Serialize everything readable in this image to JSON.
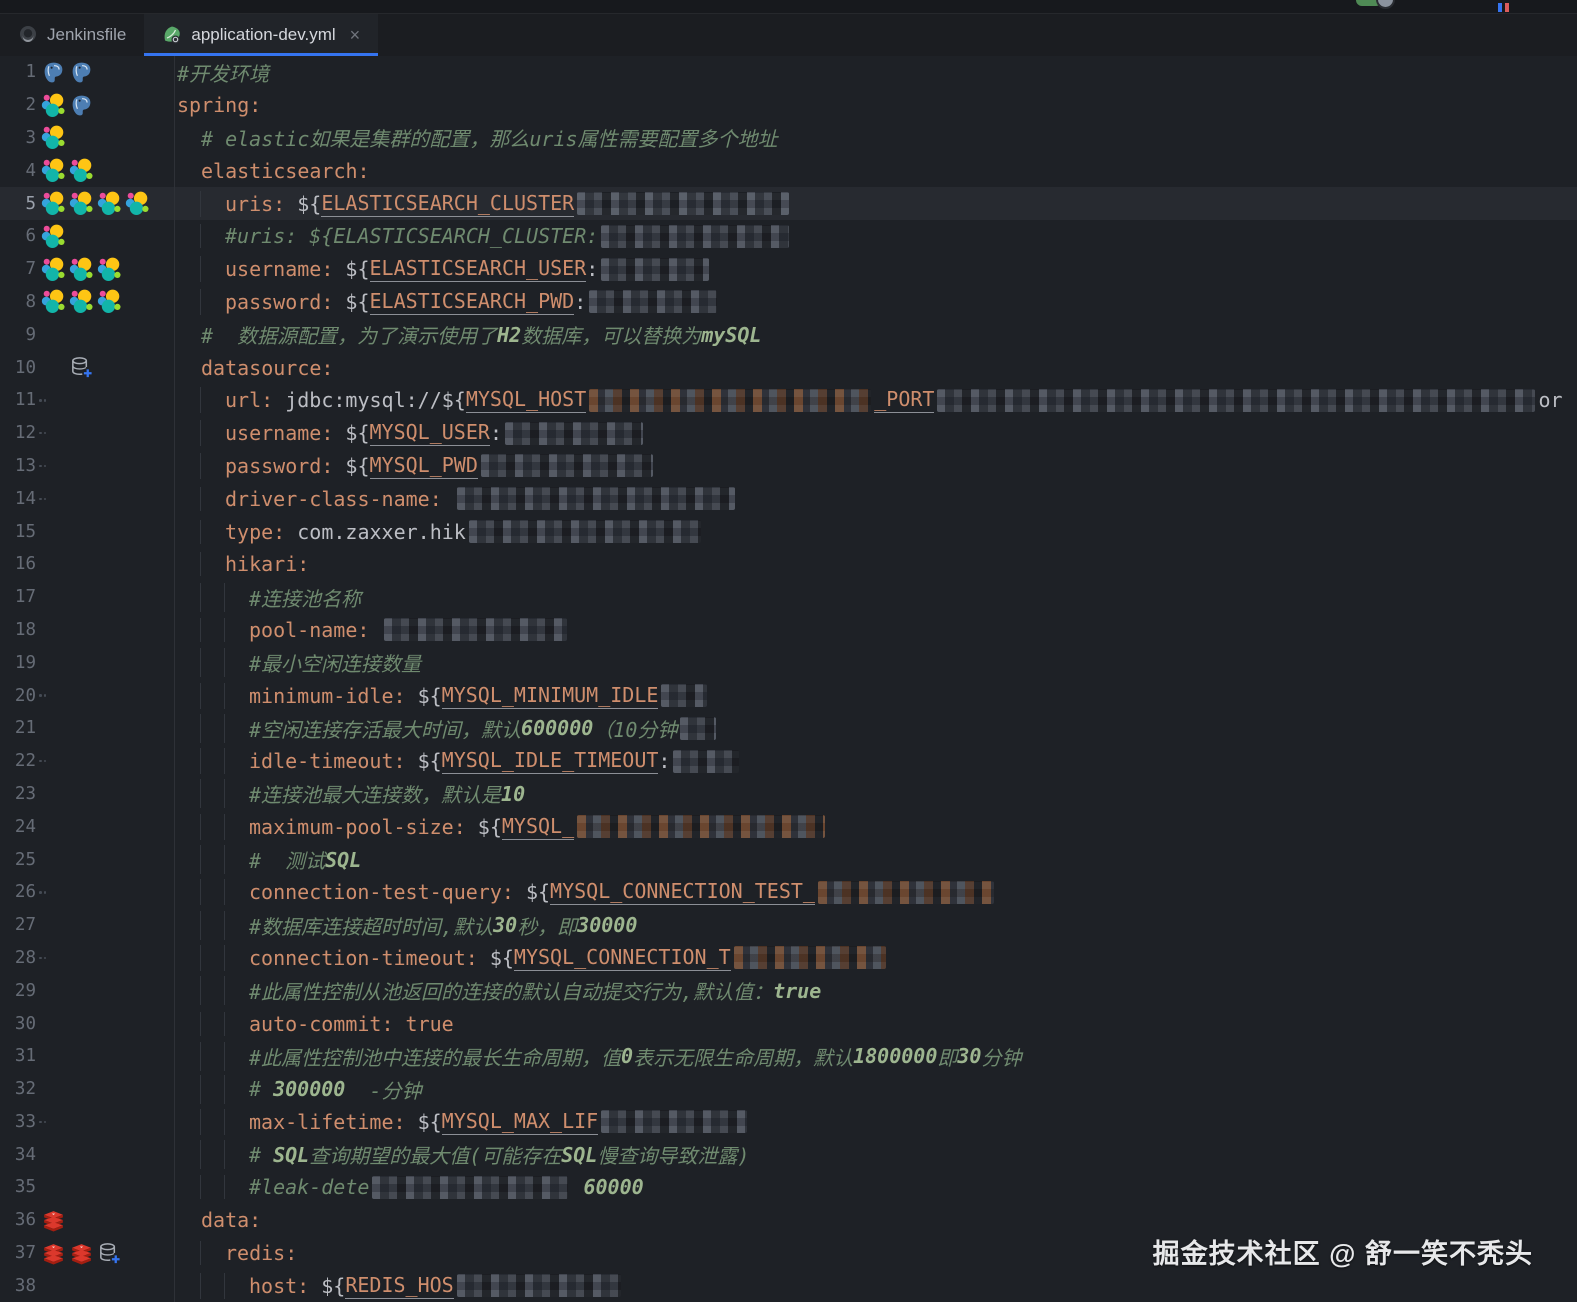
{
  "tabs": [
    {
      "label": "Jenkinsfile",
      "icon": "jenkins-icon",
      "active": false
    },
    {
      "label": "application-dev.yml",
      "icon": "spring-boot-icon",
      "active": true,
      "close": "×"
    }
  ],
  "watermark": "掘金技术社区 @ 舒一笑不秃头",
  "colors": {
    "editor_bg": "#1e2126",
    "current_line": "#272a30",
    "key": "#cf8e6d",
    "text": "#bcbec4",
    "comment": "#6f8a6f",
    "accent": "#3574f0"
  },
  "editor": {
    "file": "application-dev.yml",
    "lines": [
      {
        "n": 1,
        "icons": [
          "pg",
          "pg"
        ],
        "indent": 0,
        "seg": [
          [
            "c",
            "#开发环境"
          ]
        ]
      },
      {
        "n": 2,
        "icons": [
          "es",
          "pg"
        ],
        "indent": 0,
        "seg": [
          [
            "k",
            "spring:"
          ]
        ]
      },
      {
        "n": 3,
        "icons": [
          "es"
        ],
        "indent": 1,
        "seg": [
          [
            "c",
            "# elastic如果是集群的配置，那么uris属性需要配置多个地址"
          ]
        ]
      },
      {
        "n": 4,
        "icons": [
          "es",
          "es"
        ],
        "indent": 1,
        "seg": [
          [
            "k",
            "elasticsearch:"
          ]
        ]
      },
      {
        "n": 5,
        "icons": [
          "es",
          "es",
          "es",
          "es"
        ],
        "indent": 2,
        "current": true,
        "seg": [
          [
            "k",
            "uris: "
          ],
          [
            "p",
            "${"
          ],
          [
            "v",
            "ELASTICSEARCH_CLUSTER"
          ],
          [
            "m",
            212
          ]
        ]
      },
      {
        "n": 6,
        "icons": [
          "es"
        ],
        "indent": 2,
        "seg": [
          [
            "c",
            "#uris: ${ELASTICSEARCH_CLUSTER:"
          ],
          [
            "m",
            188
          ]
        ]
      },
      {
        "n": 7,
        "icons": [
          "es",
          "es",
          "es"
        ],
        "indent": 2,
        "seg": [
          [
            "k",
            "username: "
          ],
          [
            "p",
            "${"
          ],
          [
            "v",
            "ELASTICSEARCH_USER"
          ],
          [
            "p",
            ":"
          ],
          [
            "m",
            108
          ]
        ]
      },
      {
        "n": 8,
        "icons": [
          "es",
          "es",
          "es"
        ],
        "indent": 2,
        "seg": [
          [
            "k",
            "password: "
          ],
          [
            "p",
            "${"
          ],
          [
            "v",
            "ELASTICSEARCH_PWD"
          ],
          [
            "p",
            ":"
          ],
          [
            "m",
            128
          ]
        ]
      },
      {
        "n": 9,
        "indent": 1,
        "seg": [
          [
            "c",
            "#  数据源配置，为了演示使用了"
          ],
          [
            "cb",
            "H2"
          ],
          [
            "c",
            "数据库，可以替换为"
          ],
          [
            "cb",
            "mySQL"
          ]
        ]
      },
      {
        "n": 10,
        "icons": [
          "sp",
          "db"
        ],
        "indent": 1,
        "seg": [
          [
            "k",
            "datasource:"
          ]
        ]
      },
      {
        "n": 11,
        "dots": true,
        "indent": 2,
        "seg": [
          [
            "k",
            "url: "
          ],
          [
            "p",
            "jdbc:mysql://${"
          ],
          [
            "v",
            "MYSQL_HOST"
          ],
          [
            "mw",
            282
          ],
          [
            "v",
            "_PORT"
          ],
          [
            "m",
            598
          ],
          [
            "p",
            "or"
          ]
        ]
      },
      {
        "n": 12,
        "dots": true,
        "indent": 2,
        "seg": [
          [
            "k",
            "username: "
          ],
          [
            "p",
            "${"
          ],
          [
            "v",
            "MYSQL_USER"
          ],
          [
            "p",
            ":"
          ],
          [
            "m",
            138
          ]
        ]
      },
      {
        "n": 13,
        "dots": true,
        "indent": 2,
        "seg": [
          [
            "k",
            "password: "
          ],
          [
            "p",
            "${"
          ],
          [
            "v",
            "MYSQL_PWD"
          ],
          [
            "m",
            172
          ]
        ]
      },
      {
        "n": 14,
        "dots": true,
        "indent": 2,
        "seg": [
          [
            "k",
            "driver-class-name: "
          ],
          [
            "m",
            278
          ]
        ]
      },
      {
        "n": 15,
        "indent": 2,
        "seg": [
          [
            "k",
            "type: "
          ],
          [
            "p",
            "com.zaxxer.hik"
          ],
          [
            "m",
            232
          ]
        ]
      },
      {
        "n": 16,
        "indent": 2,
        "seg": [
          [
            "k",
            "hikari:"
          ]
        ]
      },
      {
        "n": 17,
        "indent": 3,
        "seg": [
          [
            "c",
            "#连接池名称"
          ]
        ]
      },
      {
        "n": 18,
        "indent": 3,
        "seg": [
          [
            "k",
            "pool-name: "
          ],
          [
            "m",
            183
          ]
        ]
      },
      {
        "n": 19,
        "indent": 3,
        "seg": [
          [
            "c",
            "#最小空闲连接数量"
          ]
        ]
      },
      {
        "n": 20,
        "dots": true,
        "indent": 3,
        "seg": [
          [
            "k",
            "minimum-idle: "
          ],
          [
            "p",
            "${"
          ],
          [
            "v",
            "MYSQL_MINIMUM_IDLE"
          ],
          [
            "m",
            46
          ]
        ]
      },
      {
        "n": 21,
        "indent": 3,
        "seg": [
          [
            "c",
            "#空闲连接存活最大时间，默认"
          ],
          [
            "cb",
            "600000"
          ],
          [
            "c",
            "（10分钟"
          ],
          [
            "m",
            36
          ]
        ]
      },
      {
        "n": 22,
        "dots": true,
        "indent": 3,
        "seg": [
          [
            "k",
            "idle-timeout: "
          ],
          [
            "p",
            "${"
          ],
          [
            "v",
            "MYSQL_IDLE_TIMEOUT"
          ],
          [
            "p",
            ":"
          ],
          [
            "m",
            66
          ]
        ]
      },
      {
        "n": 23,
        "indent": 3,
        "seg": [
          [
            "c",
            "#连接池最大连接数，默认是"
          ],
          [
            "cb",
            "10"
          ]
        ]
      },
      {
        "n": 24,
        "indent": 3,
        "seg": [
          [
            "k",
            "maximum-pool-size: "
          ],
          [
            "p",
            "${"
          ],
          [
            "v",
            "MYSQL_"
          ],
          [
            "mw",
            248
          ]
        ]
      },
      {
        "n": 25,
        "indent": 3,
        "seg": [
          [
            "c",
            "#  测试"
          ],
          [
            "cb",
            "SQL"
          ]
        ]
      },
      {
        "n": 26,
        "dots": true,
        "indent": 3,
        "seg": [
          [
            "k",
            "connection-test-query: "
          ],
          [
            "p",
            "${"
          ],
          [
            "v",
            "MYSQL_CONNECTION_TEST_"
          ],
          [
            "mw",
            176
          ]
        ]
      },
      {
        "n": 27,
        "indent": 3,
        "seg": [
          [
            "c",
            "#数据库连接超时时间,默认"
          ],
          [
            "cb",
            "30"
          ],
          [
            "c",
            "秒，即"
          ],
          [
            "cb",
            "30000"
          ]
        ]
      },
      {
        "n": 28,
        "dots": true,
        "indent": 3,
        "seg": [
          [
            "k",
            "connection-timeout: "
          ],
          [
            "p",
            "${"
          ],
          [
            "v",
            "MYSQL_CONNECTION_T"
          ],
          [
            "mw",
            152
          ]
        ]
      },
      {
        "n": 29,
        "indent": 3,
        "seg": [
          [
            "c",
            "#此属性控制从池返回的连接的默认自动提交行为,默认值："
          ],
          [
            "cb",
            "true"
          ]
        ]
      },
      {
        "n": 30,
        "indent": 3,
        "seg": [
          [
            "k",
            "auto-commit: "
          ],
          [
            "k",
            "true"
          ]
        ]
      },
      {
        "n": 31,
        "indent": 3,
        "seg": [
          [
            "c",
            "#此属性控制池中连接的最长生命周期，值"
          ],
          [
            "cb",
            "0"
          ],
          [
            "c",
            "表示无限生命周期，默认"
          ],
          [
            "cb",
            "1800000"
          ],
          [
            "c",
            "即"
          ],
          [
            "cb",
            "30"
          ],
          [
            "c",
            "分钟"
          ]
        ]
      },
      {
        "n": 32,
        "indent": 3,
        "seg": [
          [
            "c",
            "# "
          ],
          [
            "cb",
            "300000"
          ],
          [
            "c",
            "  -分钟"
          ]
        ]
      },
      {
        "n": 33,
        "dots": true,
        "indent": 3,
        "seg": [
          [
            "k",
            "max-lifetime: "
          ],
          [
            "p",
            "${"
          ],
          [
            "v",
            "MYSQL_MAX_LIF"
          ],
          [
            "m",
            146
          ]
        ]
      },
      {
        "n": 34,
        "indent": 3,
        "seg": [
          [
            "c",
            "# "
          ],
          [
            "cb",
            "SQL"
          ],
          [
            "c",
            "查询期望的最大值(可能存在"
          ],
          [
            "cb",
            "SQL"
          ],
          [
            "c",
            "慢查询导致泄露)"
          ]
        ]
      },
      {
        "n": 35,
        "indent": 3,
        "seg": [
          [
            "c",
            "#leak-dete"
          ],
          [
            "m",
            196
          ],
          [
            "cb",
            " 60000"
          ]
        ]
      },
      {
        "n": 36,
        "icons": [
          "rd"
        ],
        "indent": 1,
        "seg": [
          [
            "k",
            "data:"
          ]
        ]
      },
      {
        "n": 37,
        "icons": [
          "rd",
          "rd",
          "db"
        ],
        "indent": 2,
        "seg": [
          [
            "k",
            "redis:"
          ]
        ]
      },
      {
        "n": 38,
        "indent": 3,
        "seg": [
          [
            "k",
            "host: "
          ],
          [
            "p",
            "${"
          ],
          [
            "v",
            "REDIS_HOS"
          ],
          [
            "m",
            164
          ]
        ]
      }
    ]
  }
}
